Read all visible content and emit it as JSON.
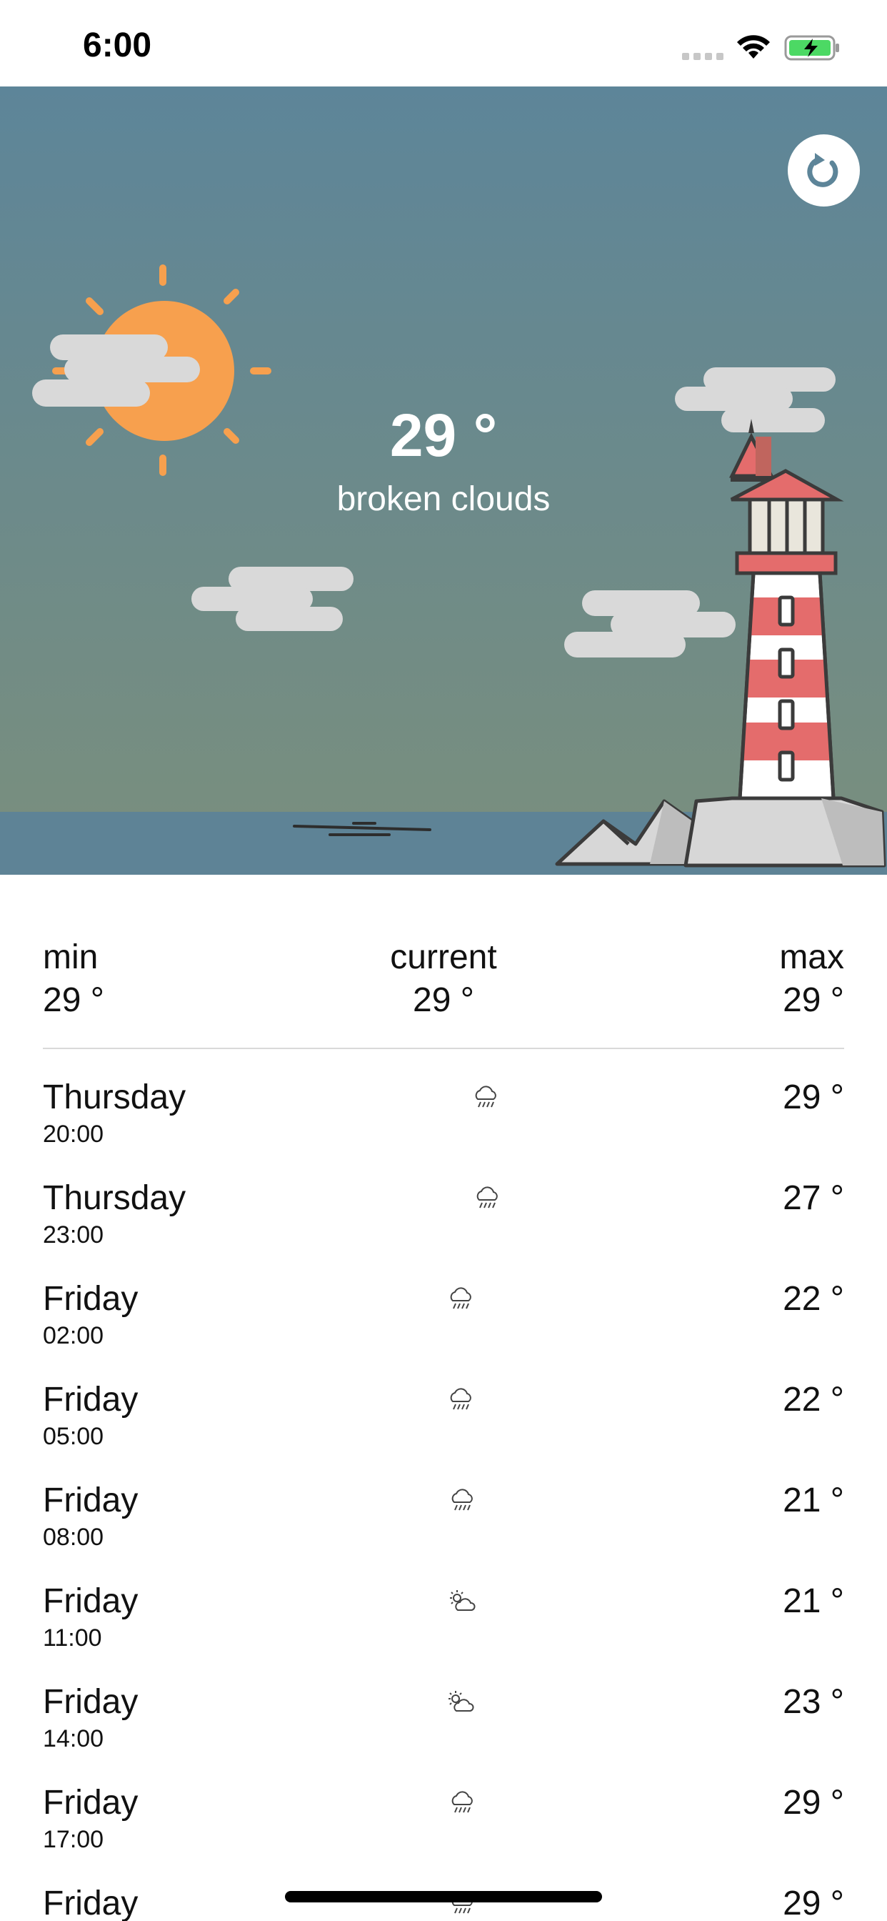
{
  "status_bar": {
    "time": "6:00"
  },
  "hero": {
    "temperature": "29 °",
    "description": "broken clouds"
  },
  "summary": {
    "min_label": "min",
    "min_value": "29 °",
    "current_label": "current",
    "current_value": "29 °",
    "max_label": "max",
    "max_value": "29 °"
  },
  "forecast": [
    {
      "day": "Thursday",
      "time": "20:00",
      "icon": "rain-cloud-icon",
      "temp": "29 °"
    },
    {
      "day": "Thursday",
      "time": "23:00",
      "icon": "rain-cloud-icon",
      "temp": "27 °"
    },
    {
      "day": "Friday",
      "time": "02:00",
      "icon": "rain-cloud-icon",
      "temp": "22 °"
    },
    {
      "day": "Friday",
      "time": "05:00",
      "icon": "rain-cloud-icon",
      "temp": "22 °"
    },
    {
      "day": "Friday",
      "time": "08:00",
      "icon": "rain-cloud-icon",
      "temp": "21 °"
    },
    {
      "day": "Friday",
      "time": "11:00",
      "icon": "partly-sunny-icon",
      "temp": "21 °"
    },
    {
      "day": "Friday",
      "time": "14:00",
      "icon": "partly-sunny-icon",
      "temp": "23 °"
    },
    {
      "day": "Friday",
      "time": "17:00",
      "icon": "rain-cloud-icon",
      "temp": "29 °"
    },
    {
      "day": "Friday",
      "time": "",
      "icon": "rain-cloud-icon",
      "temp": "29 °"
    }
  ],
  "colors": {
    "sky_top": "#5d8599",
    "sky_bottom": "#748d81",
    "sea": "#5e8396",
    "sun": "#f7a04e",
    "cloud": "#d9d9d9",
    "lighthouse_red": "#e46c6c"
  }
}
